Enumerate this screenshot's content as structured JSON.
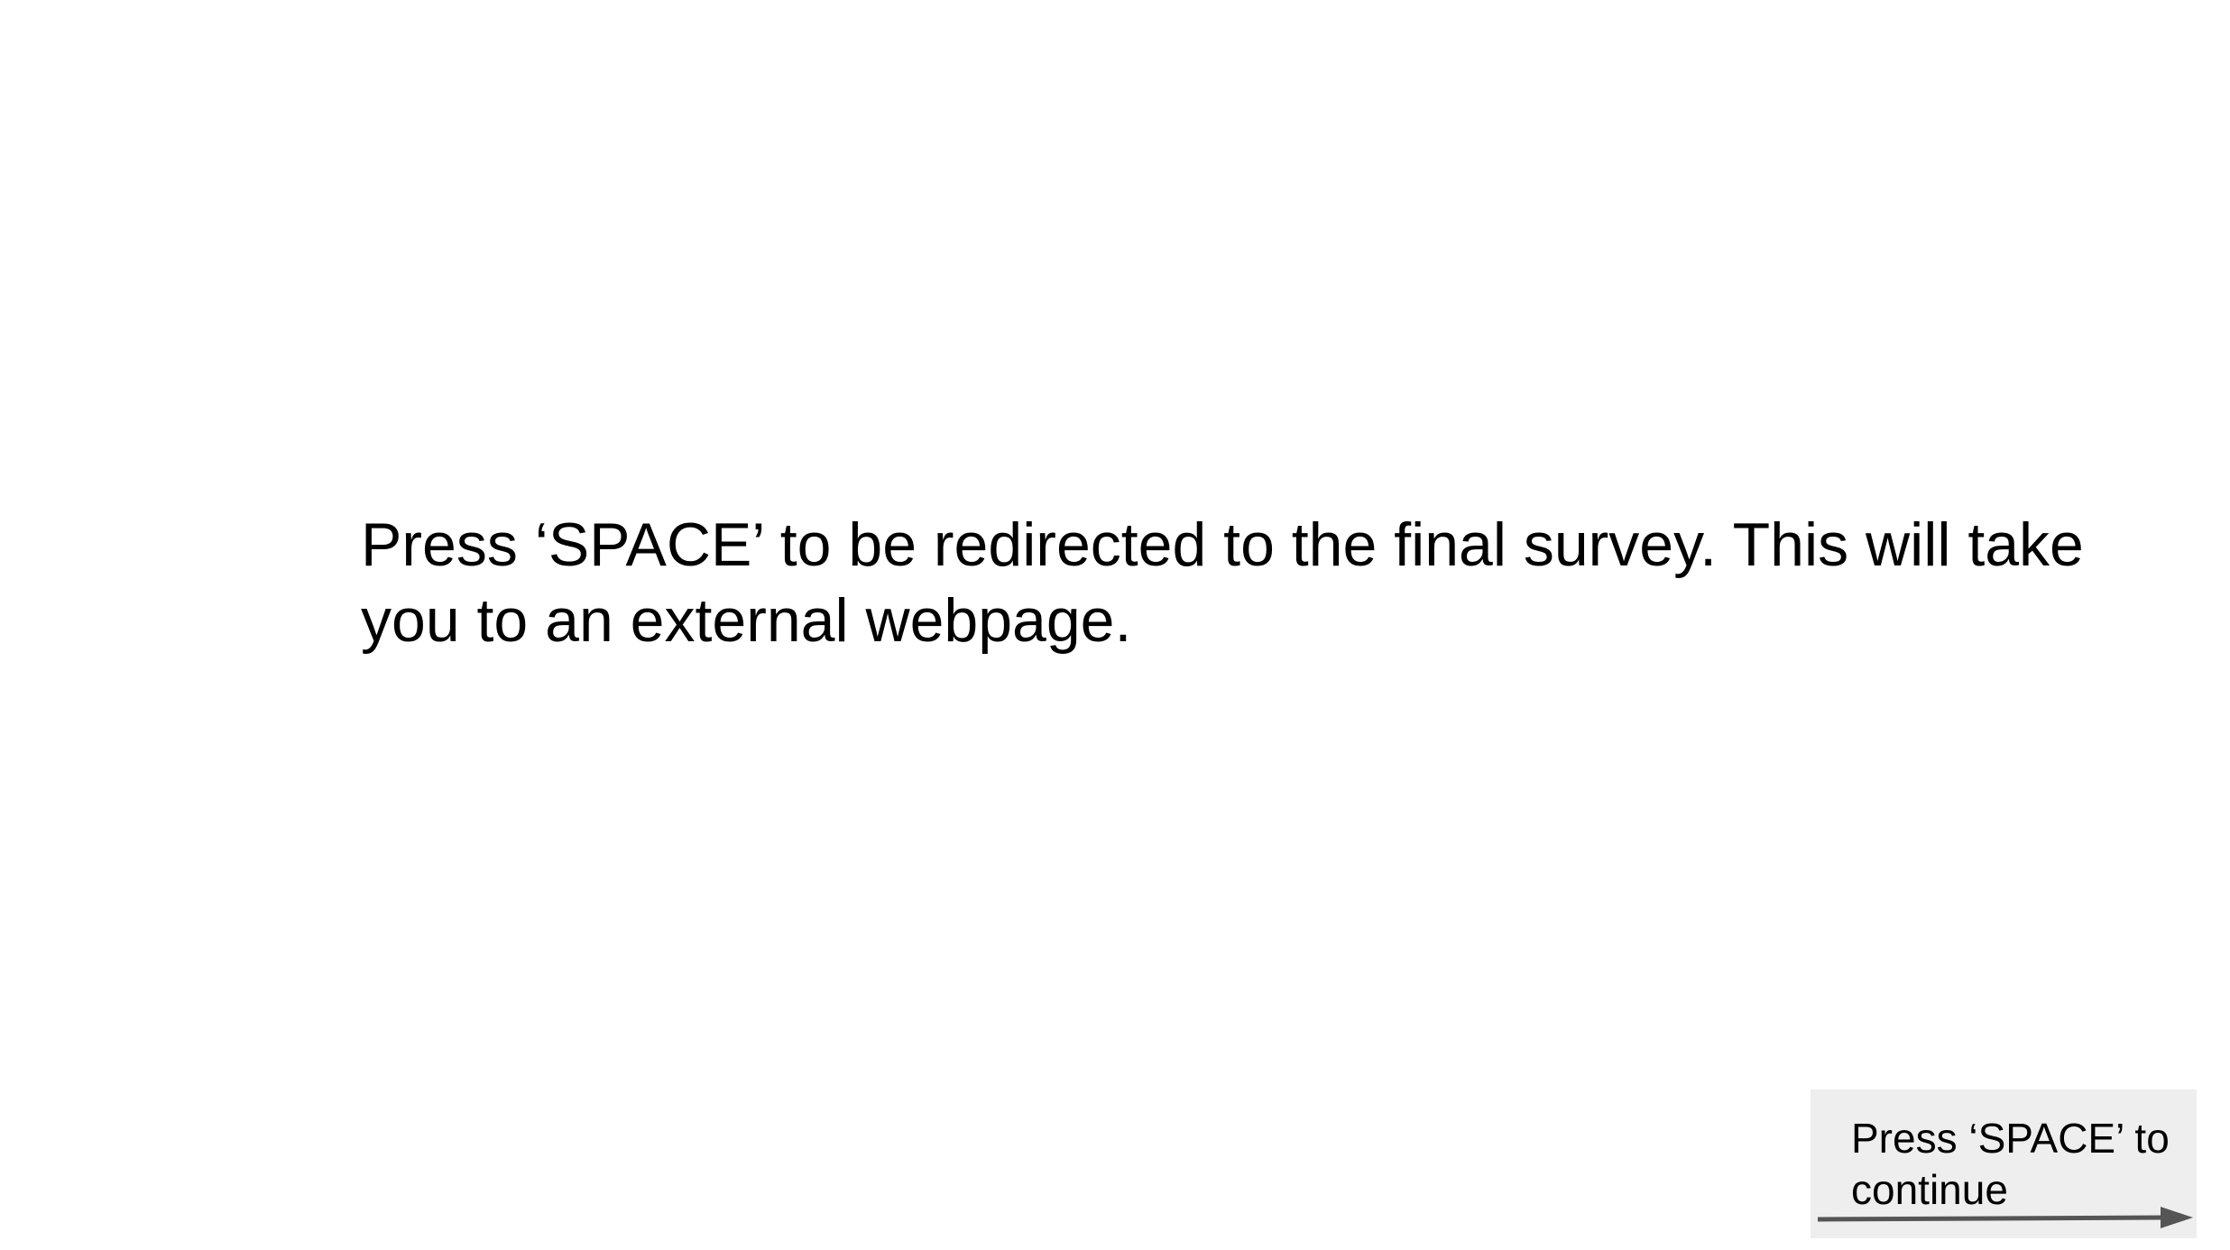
{
  "instruction": {
    "text": "Press ‘SPACE’ to be redirected to the final survey. This will take you to an external webpage."
  },
  "continue_prompt": {
    "label": "Press ‘SPACE’ to continue",
    "icon": "arrow-right-icon",
    "background_color": "#eeeeee",
    "arrow_color": "#555555"
  }
}
